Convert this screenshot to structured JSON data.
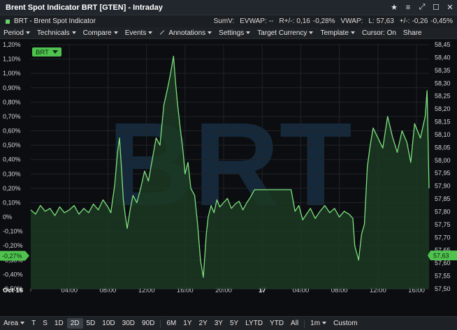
{
  "window": {
    "title": "Brent Spot Indicator BRT [GTEN] - Intraday",
    "controls": [
      "★",
      "≡",
      "⤢",
      "☐",
      "✕"
    ]
  },
  "infobar": {
    "symbol_label": "BRT - Brent Spot Indicator",
    "sumv_label": "SumV:",
    "evwap_label": "EVWAP:",
    "evwap_value": "--",
    "rchg_label": "R+/-:",
    "rchg_value": "0,16",
    "rchg_pct": "-0,28%",
    "vwap_label": "VWAP:",
    "last_label": "L:",
    "last_value": "57,63",
    "chg_label": "+/-:",
    "chg_value": "-0,26",
    "chg_pct": "-0,45%"
  },
  "menu": {
    "period": "Period",
    "technicals": "Technicals",
    "compare": "Compare",
    "events": "Events",
    "annotations": "Annotations",
    "settings": "Settings",
    "target_currency": "Target Currency",
    "template": "Template",
    "cursor": "Cursor: On",
    "share": "Share"
  },
  "bottombar": {
    "area": "Area",
    "chart_types": [
      "T",
      "S"
    ],
    "ranges": [
      "1D",
      "2D",
      "5D",
      "10D",
      "30D",
      "90D",
      "6M",
      "1Y",
      "2Y",
      "3Y",
      "5Y",
      "LYTD",
      "YTD",
      "All"
    ],
    "selected_range": "2D",
    "interval": "1m",
    "custom": "Custom"
  },
  "chart_data": {
    "type": "area",
    "symbol_tag": "BRT",
    "watermark": "BRT",
    "colors": {
      "line": "#7fe07f",
      "fill": "#1b3a22",
      "background": "#0b0d10",
      "grid": "#1f252b",
      "watermark": "#16293a"
    },
    "x_ticks": [
      "Oct 16",
      "04.00",
      "08.00",
      "12.00",
      "16.00",
      "20.00",
      "17",
      "04.00",
      "08.00",
      "12.00",
      "16.00"
    ],
    "x_tick_hours": [
      0,
      4,
      8,
      12,
      16,
      20,
      24,
      28,
      32,
      36,
      40
    ],
    "x_range_hours": [
      0,
      41.3
    ],
    "left_axis": {
      "unit": "%",
      "ylim": [
        -0.5,
        1.2
      ],
      "ticks": [
        "1,20%",
        "1,10%",
        "1,00%",
        "0,90%",
        "0,80%",
        "0,70%",
        "0,60%",
        "0,50%",
        "0,40%",
        "0,30%",
        "0,20%",
        "0,10%",
        "0%",
        "-0,10%",
        "-0,20%",
        "-0,30%",
        "-0,40%",
        "-0,50%"
      ]
    },
    "right_axis": {
      "ylim": [
        57.5,
        58.45
      ],
      "ticks": [
        "58,45",
        "58,40",
        "58,35",
        "58,30",
        "58,25",
        "58,20",
        "58,15",
        "58,10",
        "58,05",
        "58,00",
        "57,95",
        "57,90",
        "57,85",
        "57,80",
        "57,75",
        "57,70",
        "57,65",
        "57,60",
        "57,55",
        "57,50"
      ]
    },
    "left_marker": "-0,27%",
    "left_marker_value": -0.27,
    "right_marker": "57,63",
    "right_marker_value": 57.63,
    "series": [
      {
        "hours": [
          0,
          0.5,
          1,
          1.5,
          2,
          2.5,
          3,
          3.5,
          4,
          4.5,
          5,
          5.5,
          6,
          6.5,
          7,
          7.5,
          8,
          8.3,
          8.7,
          9,
          9.2,
          9.4,
          9.6,
          9.8,
          10,
          10.3,
          10.6,
          11,
          11.4,
          11.8,
          12.2,
          12.6,
          13,
          13.4,
          13.8,
          14.2,
          14.5,
          14.8,
          15,
          15.2,
          15.5,
          15.8,
          16,
          16.3,
          16.6,
          17,
          17.3,
          17.6,
          17.9,
          18.2,
          18.4,
          18.7,
          19,
          19.3,
          19.6,
          20,
          20.4,
          20.8,
          21.2,
          21.6,
          22,
          22.4,
          22.8,
          23.2,
          23.6,
          24,
          24.2,
          25,
          26,
          26.6,
          27,
          27.4,
          27.8,
          28.2,
          28.6,
          29,
          29.5,
          30,
          30.5,
          31,
          31.5,
          32,
          32.5,
          33,
          33.4,
          33.6,
          34,
          34.3,
          34.6,
          34.9,
          35.2,
          35.5,
          36,
          36.5,
          37,
          37.5,
          38,
          38.5,
          39,
          39.4,
          39.8,
          40.1,
          40.4,
          40.7,
          40.9,
          41.1,
          41.3
        ],
        "values": [
          0.05,
          0.02,
          0.08,
          0.04,
          0.06,
          0.01,
          0.07,
          0.03,
          0.05,
          0.08,
          0.02,
          0.06,
          0.03,
          0.09,
          0.05,
          0.12,
          0.07,
          0.03,
          0.22,
          0.45,
          0.55,
          0.35,
          0.12,
          0.01,
          -0.08,
          0.05,
          0.15,
          0.1,
          0.2,
          0.32,
          0.25,
          0.4,
          0.55,
          0.5,
          0.78,
          0.9,
          1.0,
          1.12,
          0.95,
          0.8,
          0.62,
          0.45,
          0.3,
          0.38,
          0.2,
          0.15,
          -0.05,
          -0.3,
          -0.42,
          -0.12,
          0.0,
          0.08,
          0.03,
          0.12,
          0.07,
          0.1,
          0.13,
          0.06,
          0.09,
          0.11,
          0.05,
          0.1,
          0.14,
          0.19,
          0.19,
          0.19,
          0.19,
          0.19,
          0.19,
          0.19,
          0.19,
          0.04,
          0.08,
          -0.02,
          0.02,
          0.06,
          -0.01,
          0.04,
          0.08,
          0.03,
          0.06,
          0.0,
          0.04,
          0.02,
          -0.01,
          -0.2,
          -0.3,
          -0.12,
          -0.05,
          0.35,
          0.5,
          0.62,
          0.55,
          0.48,
          0.7,
          0.56,
          0.45,
          0.6,
          0.52,
          0.38,
          0.65,
          0.6,
          0.55,
          0.64,
          0.7,
          0.88,
          0.2,
          -0.27
        ]
      }
    ]
  }
}
